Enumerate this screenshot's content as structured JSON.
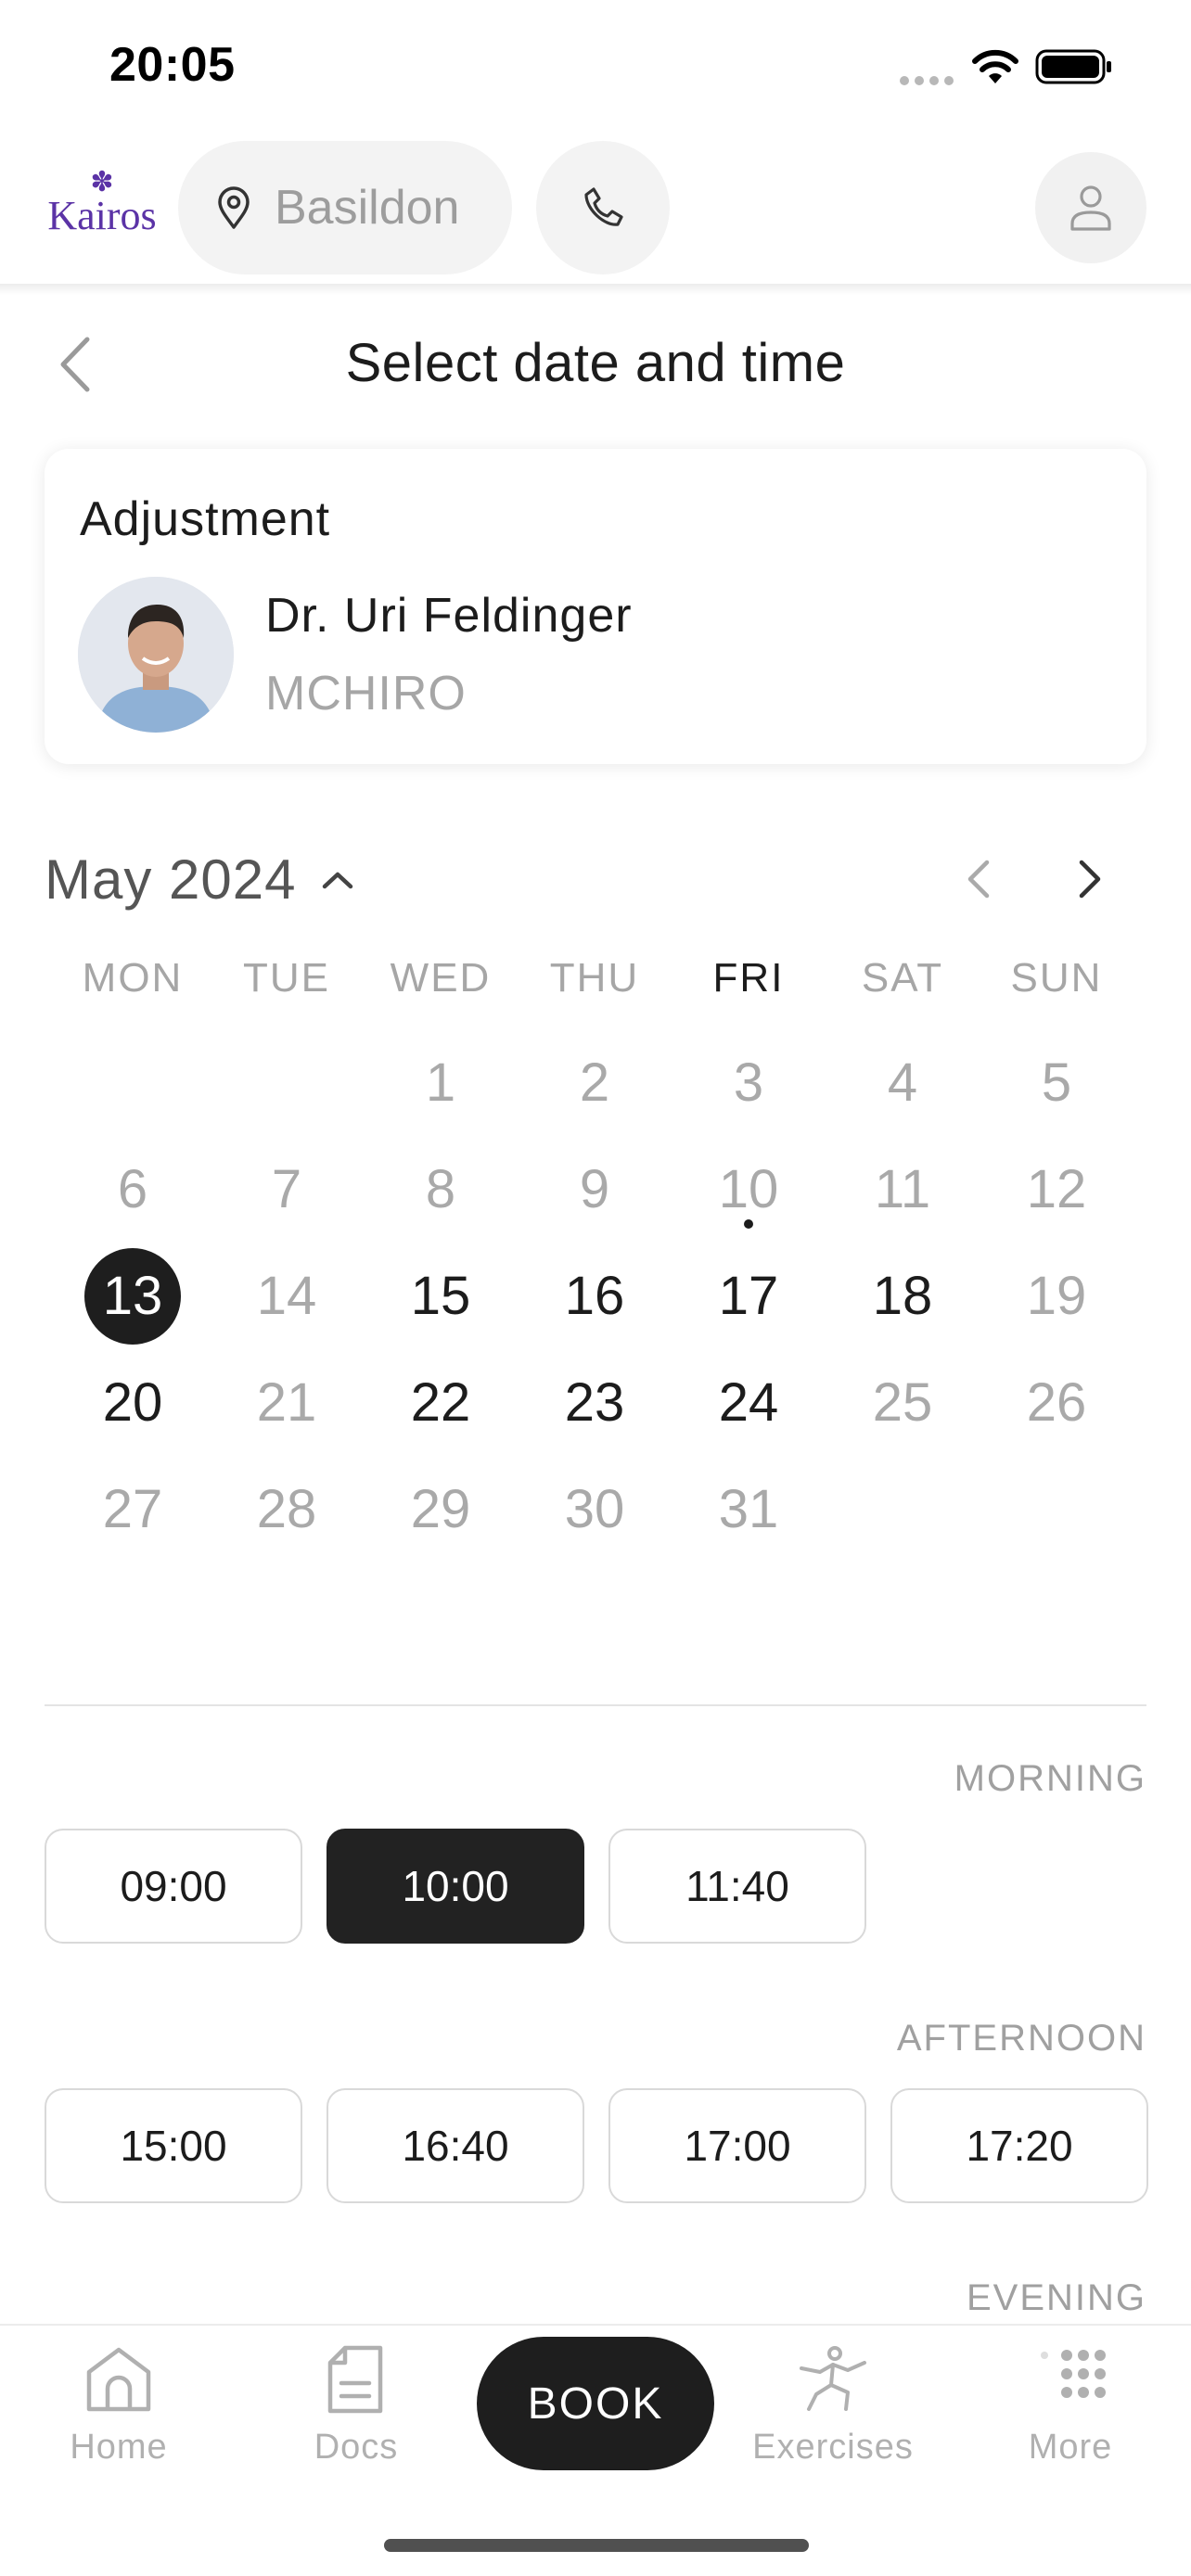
{
  "status_bar": {
    "time": "20:05"
  },
  "header": {
    "logo_text": "Kairos",
    "location": "Basildon"
  },
  "page": {
    "title": "Select date and time"
  },
  "appointment": {
    "service": "Adjustment",
    "practitioner_name": "Dr. Uri Feldinger",
    "practitioner_credentials": "MCHIRO"
  },
  "calendar": {
    "month_label": "May 2024",
    "weekdays": [
      "MON",
      "TUE",
      "WED",
      "THU",
      "FRI",
      "SAT",
      "SUN"
    ],
    "today_weekday_index": 4,
    "days": [
      {
        "label": "",
        "state": "empty"
      },
      {
        "label": "",
        "state": "empty"
      },
      {
        "label": "1",
        "state": "dim"
      },
      {
        "label": "2",
        "state": "dim"
      },
      {
        "label": "3",
        "state": "dim"
      },
      {
        "label": "4",
        "state": "dim"
      },
      {
        "label": "5",
        "state": "dim"
      },
      {
        "label": "6",
        "state": "dim"
      },
      {
        "label": "7",
        "state": "dim"
      },
      {
        "label": "8",
        "state": "dim"
      },
      {
        "label": "9",
        "state": "dim"
      },
      {
        "label": "10",
        "state": "dim",
        "today": true
      },
      {
        "label": "11",
        "state": "dim"
      },
      {
        "label": "12",
        "state": "dim"
      },
      {
        "label": "13",
        "state": "selected"
      },
      {
        "label": "14",
        "state": "dim"
      },
      {
        "label": "15",
        "state": "available"
      },
      {
        "label": "16",
        "state": "available"
      },
      {
        "label": "17",
        "state": "available"
      },
      {
        "label": "18",
        "state": "available"
      },
      {
        "label": "19",
        "state": "dim"
      },
      {
        "label": "20",
        "state": "available"
      },
      {
        "label": "21",
        "state": "dim"
      },
      {
        "label": "22",
        "state": "available"
      },
      {
        "label": "23",
        "state": "available"
      },
      {
        "label": "24",
        "state": "available"
      },
      {
        "label": "25",
        "state": "dim"
      },
      {
        "label": "26",
        "state": "dim"
      },
      {
        "label": "27",
        "state": "dim"
      },
      {
        "label": "28",
        "state": "dim"
      },
      {
        "label": "29",
        "state": "dim"
      },
      {
        "label": "30",
        "state": "dim"
      },
      {
        "label": "31",
        "state": "dim"
      }
    ]
  },
  "time_slots": {
    "morning": {
      "label": "MORNING",
      "slots": [
        {
          "time": "09:00",
          "selected": false
        },
        {
          "time": "10:00",
          "selected": true
        },
        {
          "time": "11:40",
          "selected": false
        }
      ]
    },
    "afternoon": {
      "label": "AFTERNOON",
      "slots": [
        {
          "time": "15:00",
          "selected": false
        },
        {
          "time": "16:40",
          "selected": false
        },
        {
          "time": "17:00",
          "selected": false
        },
        {
          "time": "17:20",
          "selected": false
        }
      ]
    },
    "evening": {
      "label": "EVENING"
    }
  },
  "bottom_nav": {
    "home": "Home",
    "docs": "Docs",
    "book": "BOOK",
    "exercises": "Exercises",
    "more": "More"
  },
  "colors": {
    "brand": "#5b33a6",
    "accent_dark": "#1e1e1e",
    "muted_text": "#a6a6a6"
  }
}
